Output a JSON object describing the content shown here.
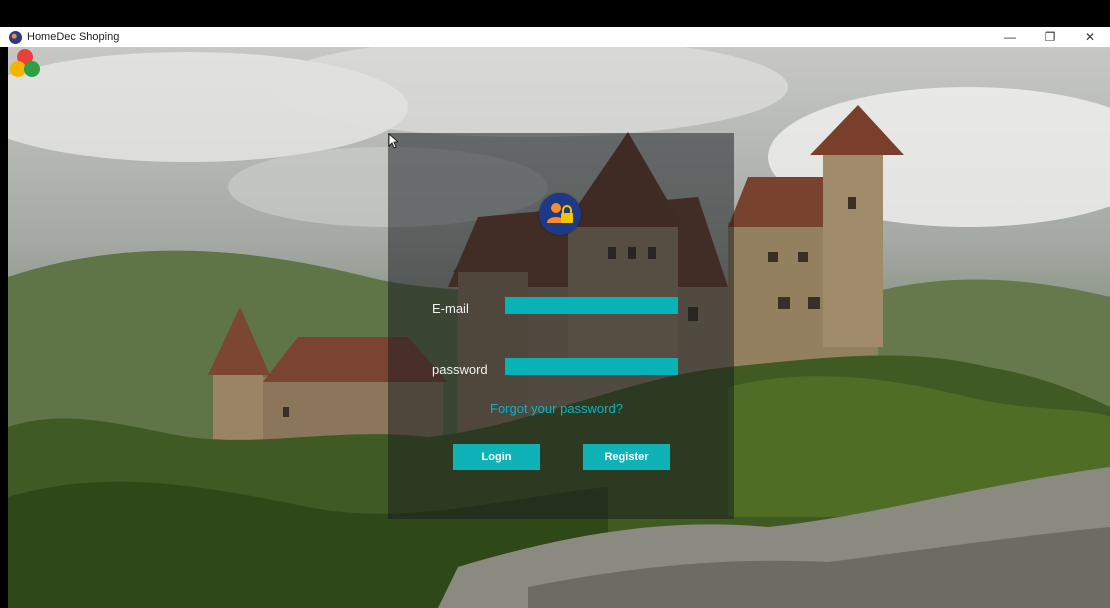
{
  "window": {
    "title": "HomeDec Shoping",
    "minimize": "—",
    "restore": "❐",
    "close": "✕"
  },
  "login": {
    "email_label": "E-mail",
    "email_value": "",
    "password_label": "password",
    "password_value": "",
    "forgot_text": "Forgot your password?",
    "login_label": "Login",
    "register_label": "Register"
  },
  "colors": {
    "accent": "#0fb2b7",
    "panel": "#191c20",
    "link": "#0fb2c2"
  },
  "icons": [
    "app-icon",
    "user-lock-icon",
    "minimize-icon",
    "restore-icon",
    "close-icon",
    "corner-logo-icon",
    "mouse-cursor-icon"
  ]
}
